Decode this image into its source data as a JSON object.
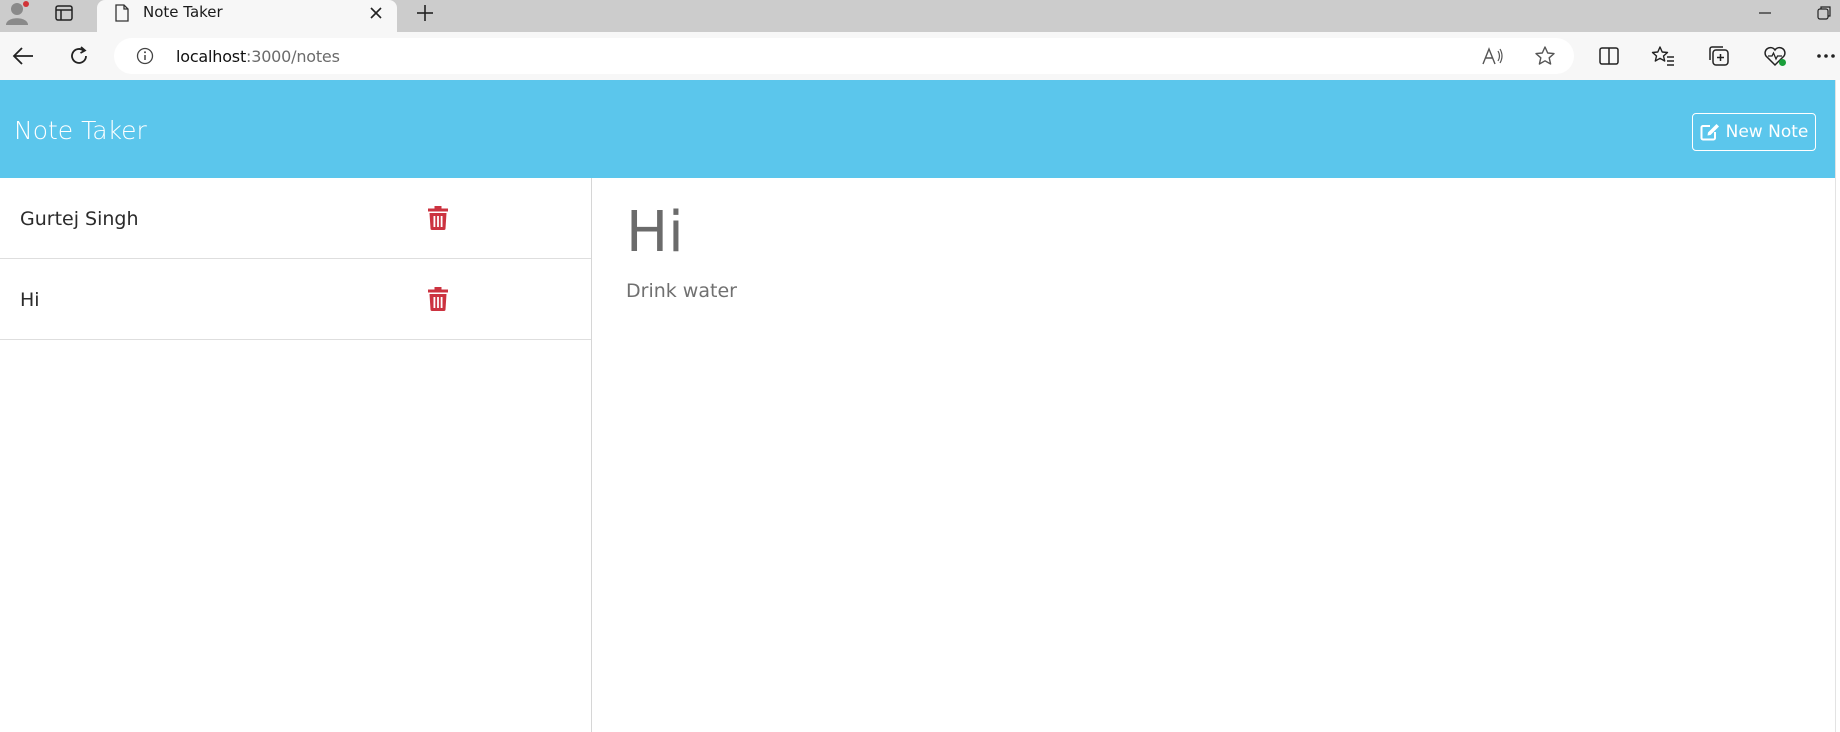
{
  "browser": {
    "tab_title": "Note Taker",
    "url_host": "localhost",
    "url_path": ":3000/notes"
  },
  "app": {
    "brand": "Note Taker",
    "new_note_label": "New Note",
    "notes": [
      {
        "title": "Gurtej Singh"
      },
      {
        "title": "Hi"
      }
    ],
    "active_note": {
      "title": "Hi",
      "text": "Drink water"
    }
  },
  "colors": {
    "navbar": "#5bc6ec",
    "delete": "#cc3340"
  }
}
